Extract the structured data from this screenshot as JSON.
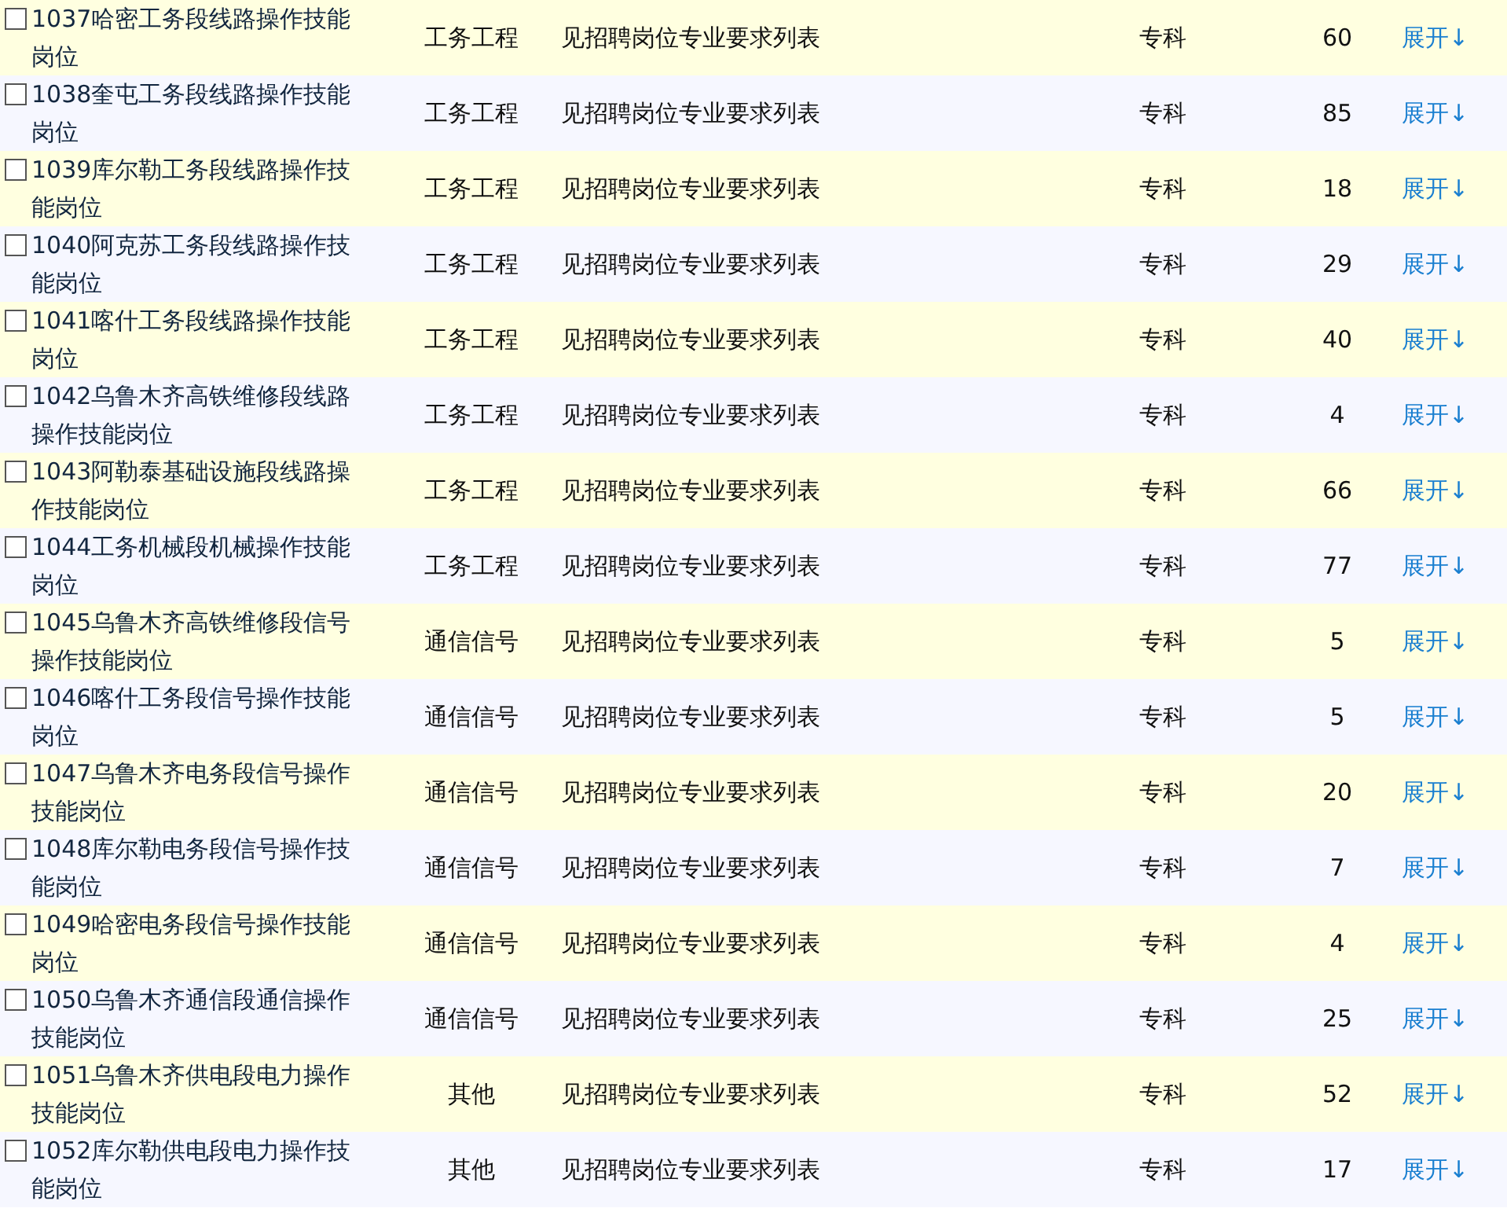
{
  "rows": [
    {
      "name": "1037哈密工务段线路操作技能岗位",
      "checked": false,
      "category": "工务工程",
      "requirement": "见招聘岗位专业要求列表",
      "education": "专科",
      "count": "60",
      "action": "展开↓"
    },
    {
      "name": "1038奎屯工务段线路操作技能岗位",
      "checked": false,
      "category": "工务工程",
      "requirement": "见招聘岗位专业要求列表",
      "education": "专科",
      "count": "85",
      "action": "展开↓"
    },
    {
      "name": "1039库尔勒工务段线路操作技能岗位",
      "checked": false,
      "category": "工务工程",
      "requirement": "见招聘岗位专业要求列表",
      "education": "专科",
      "count": "18",
      "action": "展开↓"
    },
    {
      "name": "1040阿克苏工务段线路操作技能岗位",
      "checked": false,
      "category": "工务工程",
      "requirement": "见招聘岗位专业要求列表",
      "education": "专科",
      "count": "29",
      "action": "展开↓"
    },
    {
      "name": "1041喀什工务段线路操作技能岗位",
      "checked": false,
      "category": "工务工程",
      "requirement": "见招聘岗位专业要求列表",
      "education": "专科",
      "count": "40",
      "action": "展开↓"
    },
    {
      "name": "1042乌鲁木齐高铁维修段线路操作技能岗位",
      "checked": false,
      "category": "工务工程",
      "requirement": "见招聘岗位专业要求列表",
      "education": "专科",
      "count": "4",
      "action": "展开↓"
    },
    {
      "name": "1043阿勒泰基础设施段线路操作技能岗位",
      "checked": false,
      "category": "工务工程",
      "requirement": "见招聘岗位专业要求列表",
      "education": "专科",
      "count": "66",
      "action": "展开↓"
    },
    {
      "name": "1044工务机械段机械操作技能岗位",
      "checked": false,
      "category": "工务工程",
      "requirement": "见招聘岗位专业要求列表",
      "education": "专科",
      "count": "77",
      "action": "展开↓"
    },
    {
      "name": "1045乌鲁木齐高铁维修段信号操作技能岗位",
      "checked": false,
      "category": "通信信号",
      "requirement": "见招聘岗位专业要求列表",
      "education": "专科",
      "count": "5",
      "action": "展开↓"
    },
    {
      "name": "1046喀什工务段信号操作技能岗位",
      "checked": false,
      "category": "通信信号",
      "requirement": "见招聘岗位专业要求列表",
      "education": "专科",
      "count": "5",
      "action": "展开↓"
    },
    {
      "name": "1047乌鲁木齐电务段信号操作技能岗位",
      "checked": false,
      "category": "通信信号",
      "requirement": "见招聘岗位专业要求列表",
      "education": "专科",
      "count": "20",
      "action": "展开↓"
    },
    {
      "name": "1048库尔勒电务段信号操作技能岗位",
      "checked": false,
      "category": "通信信号",
      "requirement": "见招聘岗位专业要求列表",
      "education": "专科",
      "count": "7",
      "action": "展开↓"
    },
    {
      "name": "1049哈密电务段信号操作技能岗位",
      "checked": false,
      "category": "通信信号",
      "requirement": "见招聘岗位专业要求列表",
      "education": "专科",
      "count": "4",
      "action": "展开↓"
    },
    {
      "name": "1050乌鲁木齐通信段通信操作技能岗位",
      "checked": false,
      "category": "通信信号",
      "requirement": "见招聘岗位专业要求列表",
      "education": "专科",
      "count": "25",
      "action": "展开↓"
    },
    {
      "name": "1051乌鲁木齐供电段电力操作技能岗位",
      "checked": false,
      "category": "其他",
      "requirement": "见招聘岗位专业要求列表",
      "education": "专科",
      "count": "52",
      "action": "展开↓"
    },
    {
      "name": "1052库尔勒供电段电力操作技能岗位",
      "checked": false,
      "category": "其他",
      "requirement": "见招聘岗位专业要求列表",
      "education": "专科",
      "count": "17",
      "action": "展开↓"
    }
  ]
}
